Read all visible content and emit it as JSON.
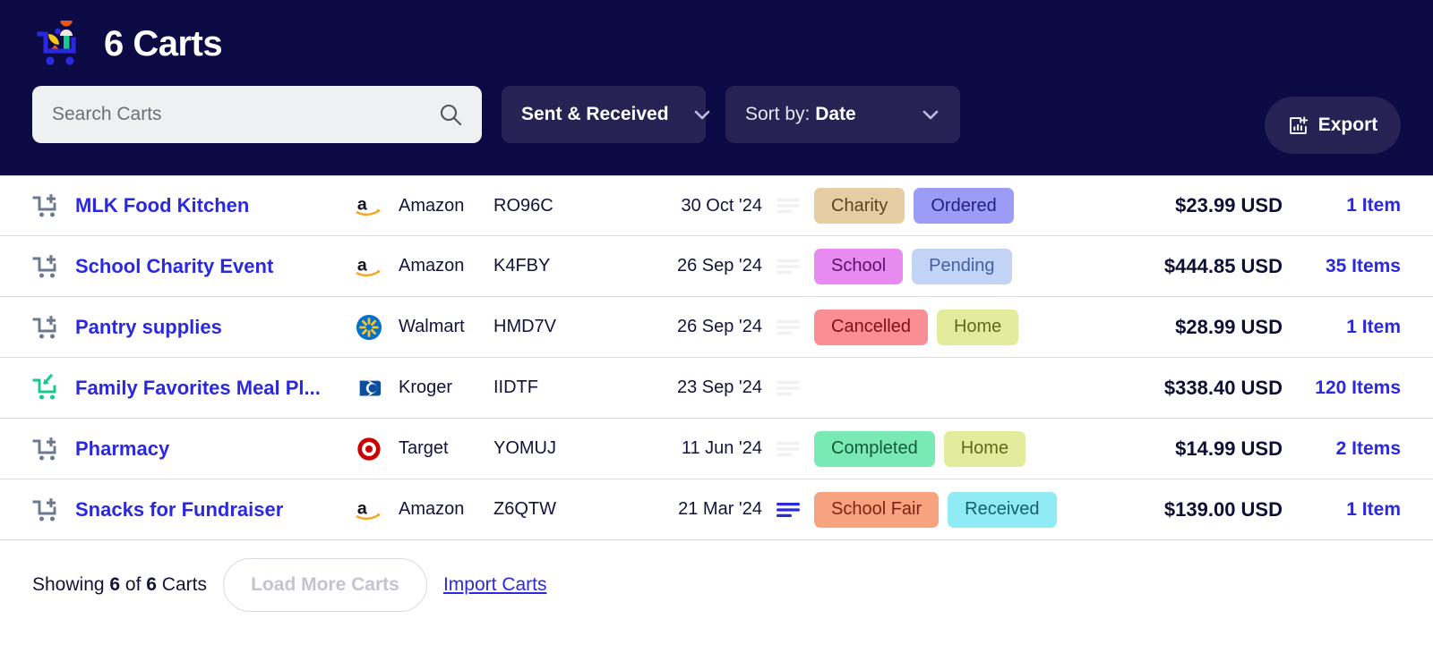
{
  "header": {
    "title": "6 Carts",
    "logo_icon": "shopping-cart-logo",
    "search": {
      "placeholder": "Search Carts",
      "value": "",
      "icon": "search-icon"
    },
    "filter_dropdown": {
      "label": "Sent & Received",
      "icon": "chevron-down-icon"
    },
    "sort_dropdown": {
      "prefix": "Sort by:",
      "value": "Date",
      "icon": "chevron-down-icon"
    },
    "export_button": {
      "label": "Export",
      "icon": "export-chart-icon"
    },
    "colors": {
      "header_bg": "#0c0a44",
      "control_bg": "#262254",
      "search_bg": "#eff0f1",
      "accent_link": "#2b29e0"
    }
  },
  "rows": [
    {
      "cart_icon": "cart-plus-icon",
      "cart_icon_color": "#6b7a90",
      "name": "MLK Food Kitchen",
      "store_logo": "amazon-logo",
      "store": "Amazon",
      "code": "RO96C",
      "date": "30 Oct '24",
      "notes_icon": "notes-lines-icon",
      "notes_active": false,
      "tags": [
        {
          "label": "Charity",
          "bg": "#e6cda3",
          "fg": "#5c4422"
        },
        {
          "label": "Ordered",
          "bg": "#9b9cf5",
          "fg": "#232080"
        }
      ],
      "total": "$23.99 USD",
      "items": "1 Item"
    },
    {
      "cart_icon": "cart-plus-icon",
      "cart_icon_color": "#6b7a90",
      "name": "School Charity Event",
      "store_logo": "amazon-logo",
      "store": "Amazon",
      "code": "K4FBY",
      "date": "26 Sep '24",
      "notes_icon": "notes-lines-icon",
      "notes_active": false,
      "tags": [
        {
          "label": "School",
          "bg": "#e88bf0",
          "fg": "#5c1166"
        },
        {
          "label": "Pending",
          "bg": "#c3d4f7",
          "fg": "#45609e"
        }
      ],
      "total": "$444.85 USD",
      "items": "35 Items"
    },
    {
      "cart_icon": "cart-plus-icon",
      "cart_icon_color": "#6b7a90",
      "name": "Pantry supplies",
      "store_logo": "walmart-logo",
      "store": "Walmart",
      "code": "HMD7V",
      "date": "26 Sep '24",
      "notes_icon": "notes-lines-icon",
      "notes_active": false,
      "tags": [
        {
          "label": "Cancelled",
          "bg": "#f98f95",
          "fg": "#7a1019"
        },
        {
          "label": "Home",
          "bg": "#e3eb9c",
          "fg": "#5e6b15"
        }
      ],
      "total": "$28.99 USD",
      "items": "1 Item"
    },
    {
      "cart_icon": "cart-download-icon",
      "cart_icon_color": "#16c98d",
      "name": "Family Favorites Meal Pl...",
      "store_logo": "kroger-logo",
      "store": "Kroger",
      "code": "IIDTF",
      "date": "23 Sep '24",
      "notes_icon": "notes-lines-icon",
      "notes_active": false,
      "tags": [],
      "total": "$338.40 USD",
      "items": "120 Items"
    },
    {
      "cart_icon": "cart-plus-icon",
      "cart_icon_color": "#6b7a90",
      "name": "Pharmacy",
      "store_logo": "target-logo",
      "store": "Target",
      "code": "YOMUJ",
      "date": "11 Jun '24",
      "notes_icon": "notes-lines-icon",
      "notes_active": false,
      "tags": [
        {
          "label": "Completed",
          "bg": "#79eab4",
          "fg": "#16593a"
        },
        {
          "label": "Home",
          "bg": "#e3eb9c",
          "fg": "#5e6b15"
        }
      ],
      "total": "$14.99 USD",
      "items": "2 Items"
    },
    {
      "cart_icon": "cart-plus-icon",
      "cart_icon_color": "#6b7a90",
      "name": "Snacks for Fundraiser",
      "store_logo": "amazon-logo",
      "store": "Amazon",
      "code": "Z6QTW",
      "date": "21 Mar '24",
      "notes_icon": "notes-lines-icon",
      "notes_active": true,
      "tags": [
        {
          "label": "School Fair",
          "bg": "#f7a380",
          "fg": "#7a2614"
        },
        {
          "label": "Received",
          "bg": "#8fecf4",
          "fg": "#14616b"
        }
      ],
      "total": "$139.00 USD",
      "items": "1 Item"
    }
  ],
  "footer": {
    "showing_prefix": "Showing ",
    "shown_count": "6",
    "showing_mid": " of ",
    "total_count": "6",
    "showing_suffix": " Carts",
    "load_more_label": "Load More Carts",
    "import_label": "Import Carts"
  }
}
